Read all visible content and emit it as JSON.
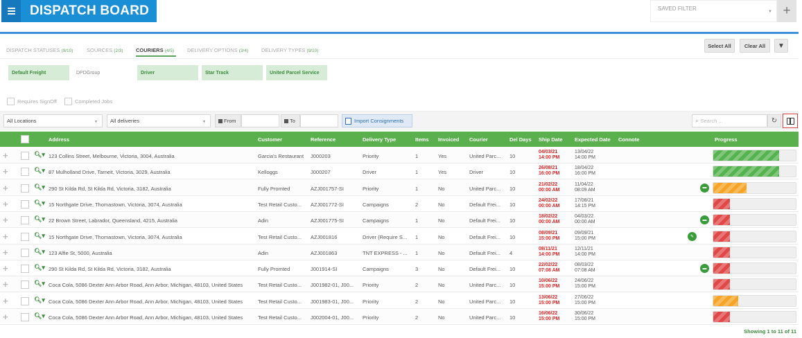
{
  "header": {
    "title": "DISPATCH BOARD",
    "menu_icon": "hamburger-icon",
    "saved_filter_label": "SAVED FILTER",
    "add_icon": "+"
  },
  "tabs": [
    {
      "label": "DISPATCH STATUSES",
      "count": "(9/10)",
      "active": false
    },
    {
      "label": "SOURCES",
      "count": "(2/3)",
      "active": false
    },
    {
      "label": "COURIERS",
      "count": "(4/5)",
      "active": true
    },
    {
      "label": "DELIVERY OPTIONS",
      "count": "(3/4)",
      "active": false
    },
    {
      "label": "DELIVERY TYPES",
      "count": "(9/10)",
      "active": false
    }
  ],
  "actions": {
    "select_all": "Select All",
    "clear_all": "Clear All",
    "filter_icon": "▼"
  },
  "couriers": [
    {
      "label": "Default Freight",
      "selected": true
    },
    {
      "label": "DPDGroup",
      "selected": false
    },
    {
      "label": "Driver",
      "selected": true
    },
    {
      "label": "Star Track",
      "selected": true
    },
    {
      "label": "United Parcel Service",
      "selected": true
    }
  ],
  "checkbox_filters": {
    "requires_signoff": "Requires SignOff",
    "completed_jobs": "Completed Jobs"
  },
  "filter_bar": {
    "locations": "All Locations",
    "deliveries": "All deliveries",
    "from_label": "From",
    "to_label": "To",
    "import_label": "Import Consignments",
    "search_placeholder": "Search ..."
  },
  "columns": {
    "address": "Address",
    "customer": "Customer",
    "reference": "Reference",
    "delivery_type": "Delivery Type",
    "items": "Items",
    "invoiced": "Invoiced",
    "courier": "Courier",
    "del_days": "Del Days",
    "ship_date": "Ship Date",
    "expected_date": "Expected Date",
    "connote": "Connote",
    "progress": "Progress"
  },
  "rows": [
    {
      "address": "123 Collins Street, Melbourne, Victoria, 3004, Australia",
      "customer": "Garcia's Restaurant",
      "reference": "J000203",
      "delivery_type": "Priority",
      "items": "1",
      "invoiced": "Yes",
      "courier": "United Parc...",
      "del_days": "10",
      "ship_date": "04/03/21",
      "ship_time": "14:00 PM",
      "exp_date": "13/04/22",
      "exp_time": "14:00 PM",
      "note": "",
      "progress": 0.8,
      "progress_color": "green"
    },
    {
      "address": "87 Mulholland Drive, Tarneit, Victoria, 3029, Australia",
      "customer": "Kelloggs",
      "reference": "J000207",
      "delivery_type": "Driver",
      "items": "1",
      "invoiced": "Yes",
      "courier": "Driver",
      "del_days": "10",
      "ship_date": "26/08/21",
      "ship_time": "16:00 PM",
      "exp_date": "18/04/22",
      "exp_time": "16:00 PM",
      "note": "",
      "progress": 0.8,
      "progress_color": "green"
    },
    {
      "address": "290 St Kilda Rd, St Kilda Rd, Victoria, 3182, Australia",
      "customer": "Fully Promted",
      "reference": "AZJ001757-SI",
      "delivery_type": "Priority",
      "items": "1",
      "invoiced": "No",
      "courier": "United Parc...",
      "del_days": "10",
      "ship_date": "21/02/22",
      "ship_time": "00:00 AM",
      "exp_date": "11/04/22",
      "exp_time": "08:09 AM",
      "note": "chat-icon",
      "progress": 0.4,
      "progress_color": "orange"
    },
    {
      "address": "15 Northgate Drive, Thomastown, Victoria, 3074, Australia",
      "customer": "Test Retail Custo...",
      "reference": "AZJ001772-SI",
      "delivery_type": "Campaigns",
      "items": "2",
      "invoiced": "No",
      "courier": "Default Frei...",
      "del_days": "10",
      "ship_date": "24/02/22",
      "ship_time": "00:00 AM",
      "exp_date": "17/08/21",
      "exp_time": "14:15 PM",
      "note": "",
      "progress": 0.2,
      "progress_color": "red"
    },
    {
      "address": "22 Brown Street, Labrador, Queensland, 4215, Australia",
      "customer": "Adin",
      "reference": "AZJ001775-SI",
      "delivery_type": "Campaigns",
      "items": "1",
      "invoiced": "No",
      "courier": "Default Frei...",
      "del_days": "10",
      "ship_date": "18/02/22",
      "ship_time": "00:00 AM",
      "exp_date": "04/03/22",
      "exp_time": "00:00 AM",
      "note": "chat-icon",
      "progress": 0.2,
      "progress_color": "red"
    },
    {
      "address": "15 Northgate Drive, Thomastown, Victoria, 3074, Australia",
      "customer": "Test Retail Custo...",
      "reference": "AZJ001816",
      "delivery_type": "Driver (Require S...",
      "items": "1",
      "invoiced": "No",
      "courier": "Default Frei...",
      "del_days": "10",
      "ship_date": "08/09/21",
      "ship_time": "15:00 PM",
      "exp_date": "09/09/21",
      "exp_time": "15:00 PM",
      "note": "edit-icon",
      "progress": 0.2,
      "progress_color": "red"
    },
    {
      "address": "123 Alfie St, 5000, Australia",
      "customer": "Adin",
      "reference": "AZJ001863",
      "delivery_type": "TNT EXPRESS - ...",
      "items": "1",
      "invoiced": "No",
      "courier": "Default Frei...",
      "del_days": "4",
      "ship_date": "08/11/21",
      "ship_time": "14:00 PM",
      "exp_date": "12/11/21",
      "exp_time": "14:00 PM",
      "note": "",
      "progress": 0.2,
      "progress_color": "red"
    },
    {
      "address": "290 St Kilda Rd, St Kilda Rd, Victoria, 3182, Australia",
      "customer": "Fully Promted",
      "reference": "J001914-SI",
      "delivery_type": "Campaigns",
      "items": "3",
      "invoiced": "No",
      "courier": "Default Frei...",
      "del_days": "10",
      "ship_date": "22/02/22",
      "ship_time": "07:08 AM",
      "exp_date": "08/03/22",
      "exp_time": "07:08 AM",
      "note": "chat-icon",
      "progress": 0.2,
      "progress_color": "red"
    },
    {
      "address": "Coca Cola, 5086 Dexter Ann Arbor Road, Ann Arbor, Michigan, 48103, United States",
      "customer": "Test Retail Custo...",
      "reference": "J001982-01, J00...",
      "delivery_type": "Priority",
      "items": "2",
      "invoiced": "No",
      "courier": "United Parc...",
      "del_days": "10",
      "ship_date": "10/06/22",
      "ship_time": "15:00 PM",
      "exp_date": "24/06/22",
      "exp_time": "15:00 PM",
      "note": "",
      "progress": 0.2,
      "progress_color": "red"
    },
    {
      "address": "Coca Cola, 5086 Dexter Ann Arbor Road, Ann Arbor, Michigan, 48103, United States",
      "customer": "Test Retail Custo...",
      "reference": "J001983-01, J00...",
      "delivery_type": "Priority",
      "items": "2",
      "invoiced": "No",
      "courier": "United Parc...",
      "del_days": "10",
      "ship_date": "13/06/22",
      "ship_time": "15:00 PM",
      "exp_date": "27/06/22",
      "exp_time": "15:00 PM",
      "note": "",
      "progress": 0.3,
      "progress_color": "orange"
    },
    {
      "address": "Coca Cola, 5086 Dexter Ann Arbor Road, Ann Arbor, Michigan, 48103, United States",
      "customer": "Test Retail Custo...",
      "reference": "J002004-01, J00...",
      "delivery_type": "Priority",
      "items": "2",
      "invoiced": "No",
      "courier": "United Parc...",
      "del_days": "10",
      "ship_date": "16/06/22",
      "ship_time": "15:00 PM",
      "exp_date": "30/06/22",
      "exp_time": "15:00 PM",
      "note": "",
      "progress": 0.2,
      "progress_color": "red"
    }
  ],
  "footer": {
    "info": "Showing 1 to 11 of 11"
  },
  "colors": {
    "brand": "#1a8fd6",
    "header_green": "#5bb04e",
    "ship_red": "#e21f1f",
    "chip_green": "#d7ecd7"
  }
}
